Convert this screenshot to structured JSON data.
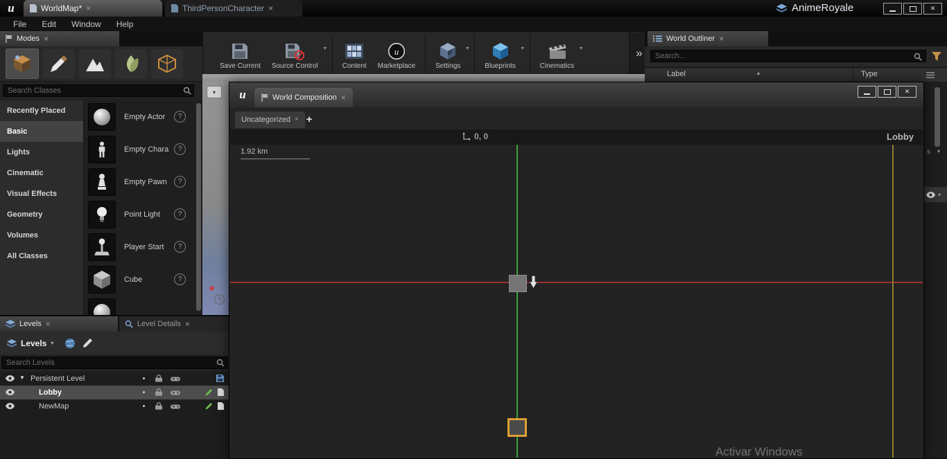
{
  "app": {
    "tabs": [
      {
        "label": "WorldMap*"
      },
      {
        "label": "ThirdPersonCharacter"
      }
    ],
    "project_name": "AnimeRoyale",
    "menu": [
      "File",
      "Edit",
      "Window",
      "Help"
    ]
  },
  "toolbar": {
    "buttons": [
      {
        "label": "Save Current"
      },
      {
        "label": "Source Control"
      },
      {
        "label": "Content"
      },
      {
        "label": "Marketplace"
      },
      {
        "label": "Settings"
      },
      {
        "label": "Blueprints"
      },
      {
        "label": "Cinematics"
      }
    ],
    "overflow": "»"
  },
  "modes": {
    "tab": "Modes",
    "search_placeholder": "Search Classes",
    "categories": [
      "Recently Placed",
      "Basic",
      "Lights",
      "Cinematic",
      "Visual Effects",
      "Geometry",
      "Volumes",
      "All Classes"
    ],
    "selected_category": "Basic",
    "items": [
      "Empty Actor",
      "Empty Chara",
      "Empty Pawn",
      "Point Light",
      "Player Start",
      "Cube"
    ]
  },
  "outliner": {
    "tab": "World Outliner",
    "search_placeholder": "Search...",
    "col_label": "Label",
    "col_type": "Type"
  },
  "composition": {
    "tab": "World Composition",
    "layer_tab": "Uncategorized",
    "origin": "0, 0",
    "scale": "1.92 km",
    "level_name": "Lobby"
  },
  "levels": {
    "tab_levels": "Levels",
    "tab_details": "Level Details",
    "dropdown": "Levels",
    "search_placeholder": "Search Levels",
    "rows": [
      {
        "name": "Persistent Level",
        "selected": false
      },
      {
        "name": "Lobby",
        "selected": true
      },
      {
        "name": "NewMap",
        "selected": false
      }
    ]
  },
  "sliver": {
    "partial_text": "s"
  },
  "watermark": "Activar Windows",
  "glyphs": {
    "close": "×",
    "x": "✕",
    "caret": "▾",
    "plus": "+",
    "sort": "▲",
    "asterisk": "*",
    "help": "?",
    "u": "u",
    "expand": "▼"
  },
  "colors": {
    "accent_orange": "#dd9f33",
    "grid_green": "#3aa23a",
    "grid_red": "#9b3030",
    "grid_yellow": "#8f7d2e",
    "selection": "#4d4d4d"
  }
}
